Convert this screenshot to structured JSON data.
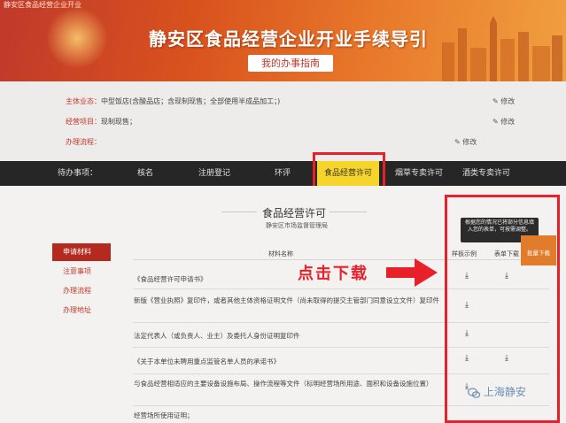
{
  "browser": {
    "tab_title": "静安区食品经营企业开业"
  },
  "banner": {
    "title": "静安区食品经营企业开业手续导引",
    "subtitle": "我的办事指南"
  },
  "info": {
    "rows": [
      {
        "label": "主体业态：",
        "value": "中型饭店(含酸品店；含现制现售；全部使用半成品加工；)"
      },
      {
        "label": "经营项目：",
        "value": "现制现售；"
      },
      {
        "label": "办理流程：",
        "value": ""
      }
    ],
    "edit_label": "修改"
  },
  "nav": {
    "prefix": "待办事项：",
    "items": [
      "核名",
      "注册登记",
      "环评",
      "食品经营许可",
      "烟草专卖许可",
      "酒类专卖许可"
    ],
    "active": "食品经营许可"
  },
  "section": {
    "title": "食品经营许可",
    "subtitle": "静安区市场监督管理局"
  },
  "sidebar": {
    "items": [
      "申请材料",
      "注意事项",
      "办理流程",
      "办理地址"
    ]
  },
  "table": {
    "headers": {
      "name": "材料名称",
      "sample": "样板示例",
      "form": "表单下载"
    },
    "rows": [
      {
        "name": "《食品经营许可申请书》",
        "sample": true,
        "form": true
      },
      {
        "name": "新版《营业执照》复印件，或者其他主体资格证明文件（尚未取得的提交主管部门同意设立文件）复印件",
        "sample": true,
        "form": false
      },
      {
        "name": "法定代表人（或负责人、业主）及委托人身份证明复印件",
        "sample": true,
        "form": false
      },
      {
        "name": "《关于本单位未聘用重点监管名单人员的承诺书》",
        "sample": true,
        "form": true
      },
      {
        "name": "与食品经营相适应的主要设备设施布局、操作流程等文件（标明经营场所用途、面积和设备设施位置）",
        "sample": true,
        "form": false
      },
      {
        "name": "经营场所使用证明；",
        "sample": false,
        "form": false
      }
    ]
  },
  "annotation": {
    "click_text": "点击下载"
  },
  "tooltip": {
    "text": "根据您的情况已将部分信息填入您的表单，可按需调整。"
  },
  "batch_button": {
    "label": "批量下载"
  },
  "watermark": {
    "text": "上海静安"
  },
  "colors": {
    "accent_red": "#e8202a",
    "nav_active": "#f6d52b",
    "nav_bg": "#262626",
    "sidebar_active": "#b42a1e"
  }
}
